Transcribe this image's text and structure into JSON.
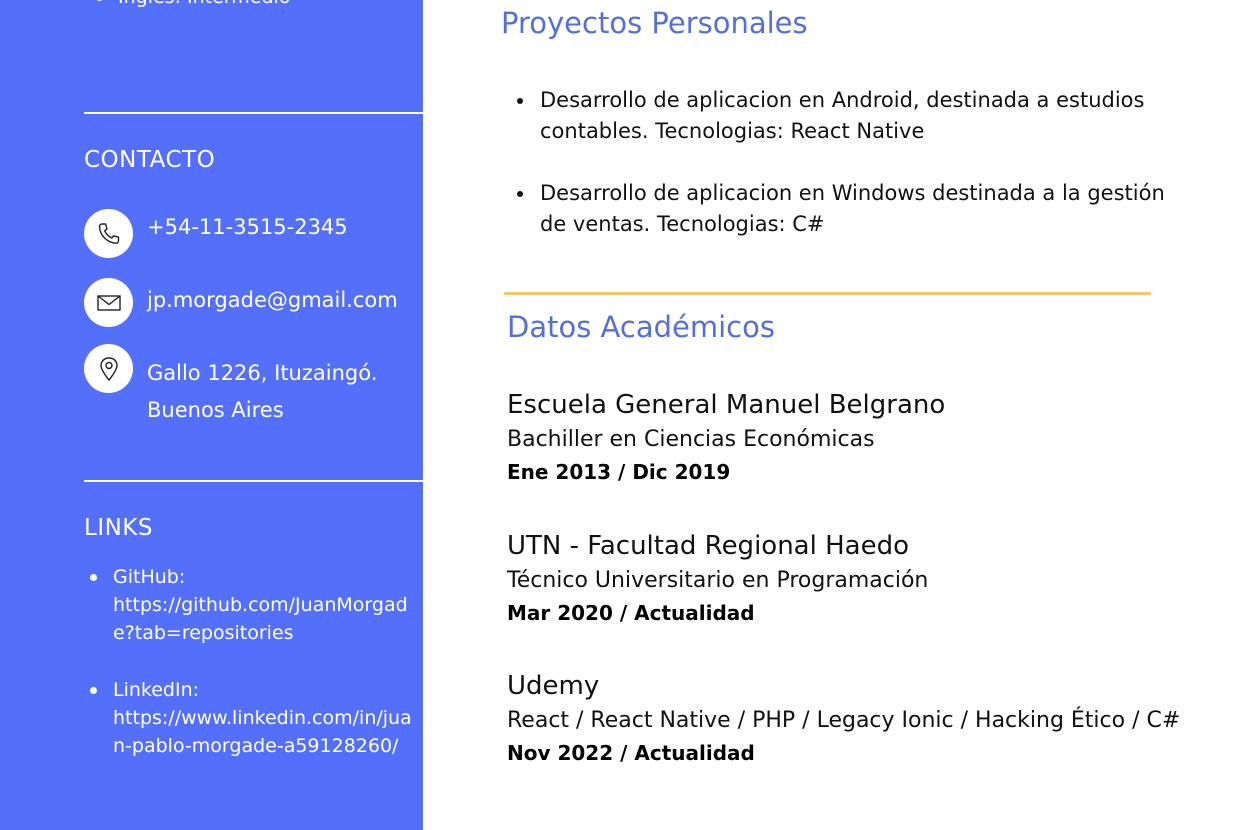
{
  "sidebar": {
    "language_item": "Inglés: Intermedio",
    "contact": {
      "heading": "CONTACTO",
      "phone": "+54-11-3515-2345",
      "email": "jp.morgade@gmail.com",
      "address_line1": "Gallo 1226, Ituzaingó.",
      "address_line2": "Buenos Aires"
    },
    "links": {
      "heading": "LINKS",
      "items": [
        {
          "label": "GitHub:",
          "url": "https://github.com/JuanMorgade?tab=repositories"
        },
        {
          "label": "LinkedIn:",
          "url": "https://www.linkedin.com/in/juan-pablo-morgade-a59128260/"
        }
      ]
    }
  },
  "projects": {
    "heading": "Proyectos Personales",
    "items": [
      "Desarrollo de aplicacion en Android, destinada a estudios contables. Tecnologias: React Native",
      "Desarrollo de aplicacion en Windows destinada a la gestión de ventas. Tecnologias: C#"
    ]
  },
  "academic": {
    "heading": "Datos Académicos",
    "entries": [
      {
        "school": "Escuela General Manuel Belgrano",
        "degree": "Bachiller en Ciencias Económicas",
        "dates": "Ene 2013 / Dic 2019"
      },
      {
        "school": "UTN - Facultad Regional Haedo",
        "degree": "Técnico Universitario en Programación",
        "dates": "Mar 2020 / Actualidad"
      },
      {
        "school": "Udemy",
        "degree": "React / React Native / PHP / Legacy Ionic / Hacking Ético / C#",
        "dates": "Nov 2022 / Actualidad"
      }
    ]
  },
  "colors": {
    "sidebar_bg": "#5470fb",
    "heading_blue": "#5470d8",
    "divider_gold": "#f6c96a"
  },
  "icons": [
    "phone-icon",
    "mail-icon",
    "location-pin-icon"
  ]
}
